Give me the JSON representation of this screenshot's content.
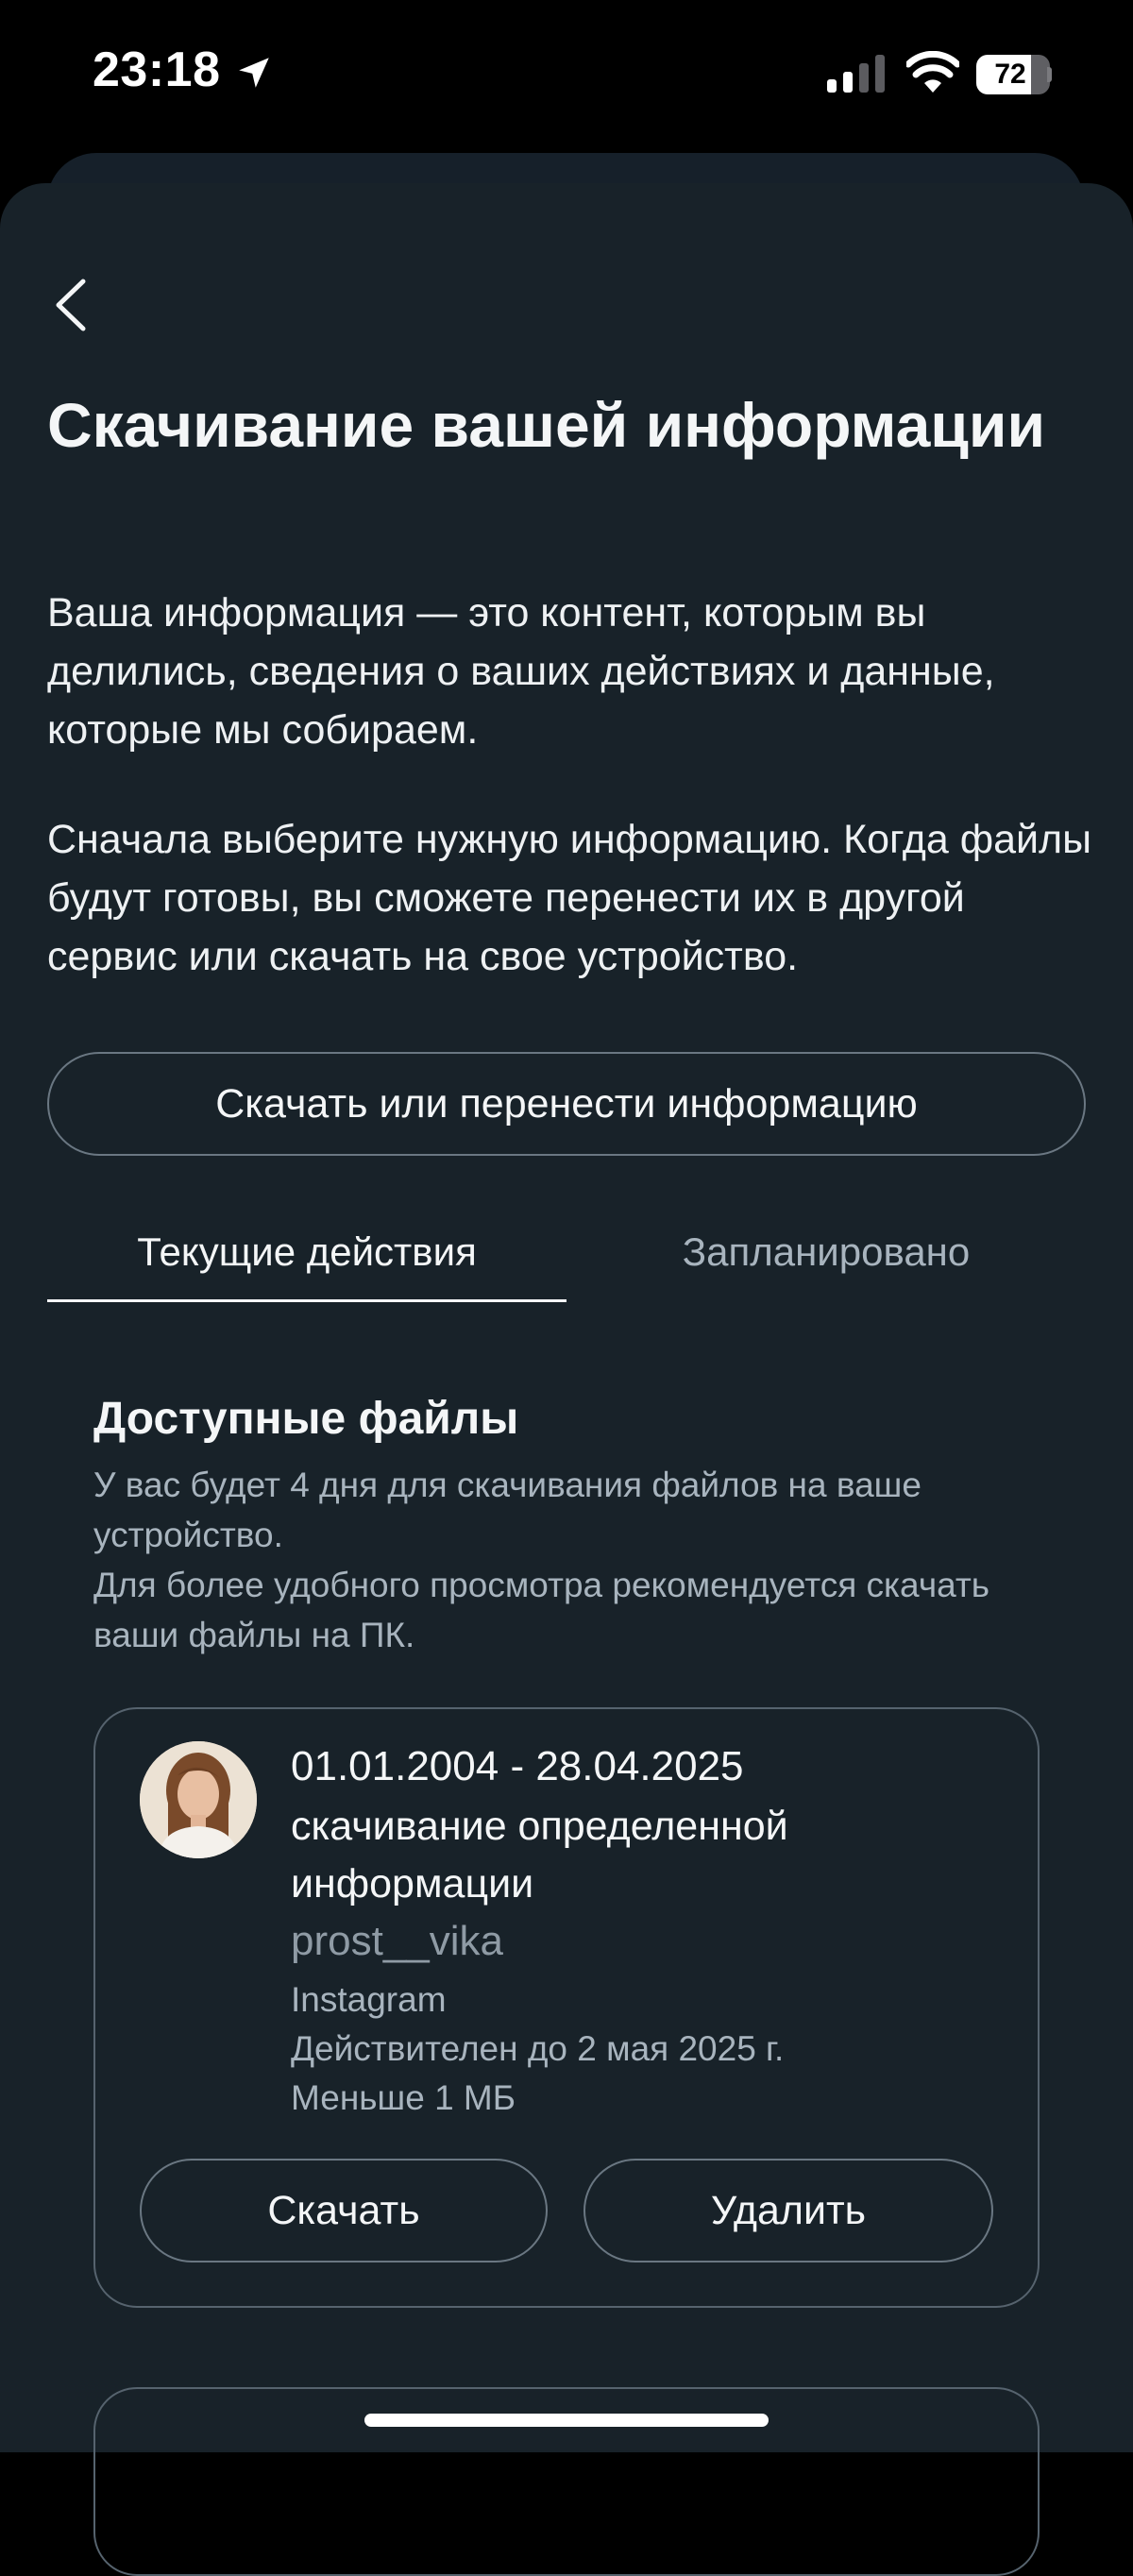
{
  "status_bar": {
    "time": "23:18",
    "battery": "72",
    "battery_level": 0.72,
    "icons": [
      "location-arrow-icon",
      "cellular-signal-icon",
      "wifi-icon",
      "battery-icon"
    ]
  },
  "nav": {
    "back_icon": "chevron-left-icon"
  },
  "page": {
    "title": "Скачивание вашей информации",
    "description_1": "Ваша информация — это контент, которым вы делились, сведения о ваших действиях и данные, которые мы собираем.",
    "description_2": "Сначала выберите нужную информацию. Когда файлы будут готовы, вы сможете перенести их в другой сервис или скачать на свое устройство.",
    "primary_button": "Скачать или перенести информацию"
  },
  "tabs": [
    {
      "label": "Текущие действия",
      "active": true
    },
    {
      "label": "Запланировано",
      "active": false
    }
  ],
  "available_files": {
    "title": "Доступные файлы",
    "note": "У вас будет 4 дня для скачивания файлов на ваше устройство.\nДля более удобного просмотра рекомендуется скачать ваши файлы на ПК.",
    "items": [
      {
        "date_range": "01.01.2004 - 28.04.2025",
        "type": "скачивание определенной информации",
        "username": "prost__vika",
        "app": "Instagram",
        "valid_until": "Действителен до 2 мая 2025 г.",
        "size": "Меньше 1 МБ",
        "download_label": "Скачать",
        "delete_label": "Удалить"
      }
    ]
  },
  "colors": {
    "sheet_background": "#182229",
    "border": "#56636e",
    "secondary_text": "#a8b4be",
    "primary_text": "#f4f6f7"
  }
}
